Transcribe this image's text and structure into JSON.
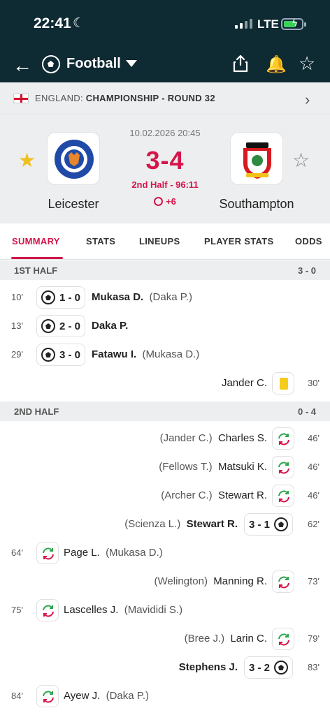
{
  "status": {
    "time": "22:41",
    "network": "LTE"
  },
  "header": {
    "sport": "Football",
    "icons": [
      "back-arrow-icon",
      "football-icon",
      "share-icon",
      "bell-icon",
      "star-icon"
    ]
  },
  "league": {
    "country": "ENGLAND:",
    "competition": "CHAMPIONSHIP - ROUND 32"
  },
  "match": {
    "datetime": "10.02.2026 20:45",
    "score": "3-4",
    "period": "2nd Half - 96:11",
    "added_time": "+6",
    "home": {
      "name": "Leicester"
    },
    "away": {
      "name": "Southampton"
    }
  },
  "tabs": [
    "SUMMARY",
    "STATS",
    "LINEUPS",
    "PLAYER STATS",
    "ODDS"
  ],
  "first_half": {
    "label": "1ST HALF",
    "score": "3 - 0",
    "events": [
      {
        "minute": "10'",
        "score": "1 - 0",
        "player": "Mukasa D.",
        "assist": "(Daka P.)"
      },
      {
        "minute": "13'",
        "score": "2 - 0",
        "player": "Daka P.",
        "assist": ""
      },
      {
        "minute": "29'",
        "score": "3 - 0",
        "player": "Fatawu I.",
        "assist": "(Mukasa D.)"
      },
      {
        "minute": "30'",
        "player": "Jander C."
      }
    ]
  },
  "second_half": {
    "label": "2ND HALF",
    "score": "0 - 4",
    "events": [
      {
        "minute": "46'",
        "player": "Charles S.",
        "assist": "(Jander C.)"
      },
      {
        "minute": "46'",
        "player": "Matsuki K.",
        "assist": "(Fellows T.)"
      },
      {
        "minute": "46'",
        "player": "Stewart R.",
        "assist": "(Archer C.)"
      },
      {
        "minute": "62'",
        "player": "Stewart R.",
        "assist": "(Scienza L.)",
        "score": "3 - 1"
      },
      {
        "minute": "64'",
        "player": "Page L.",
        "assist": "(Mukasa D.)"
      },
      {
        "minute": "73'",
        "player": "Manning R.",
        "assist": "(Welington)"
      },
      {
        "minute": "75'",
        "player": "Lascelles J.",
        "assist": "(Mavididi S.)"
      },
      {
        "minute": "79'",
        "player": "Larin C.",
        "assist": "(Bree J.)"
      },
      {
        "minute": "83'",
        "player": "Stephens J.",
        "score": "3 - 2"
      },
      {
        "minute": "84'",
        "player": "Ayew J.",
        "assist": "(Daka P.)"
      }
    ]
  },
  "colors": {
    "accent": "#d4164a",
    "header_bg": "#0e2a33",
    "yellow_card": "#f5cb1c",
    "sub_green": "#2fa84f",
    "sub_red": "#d4164a"
  }
}
